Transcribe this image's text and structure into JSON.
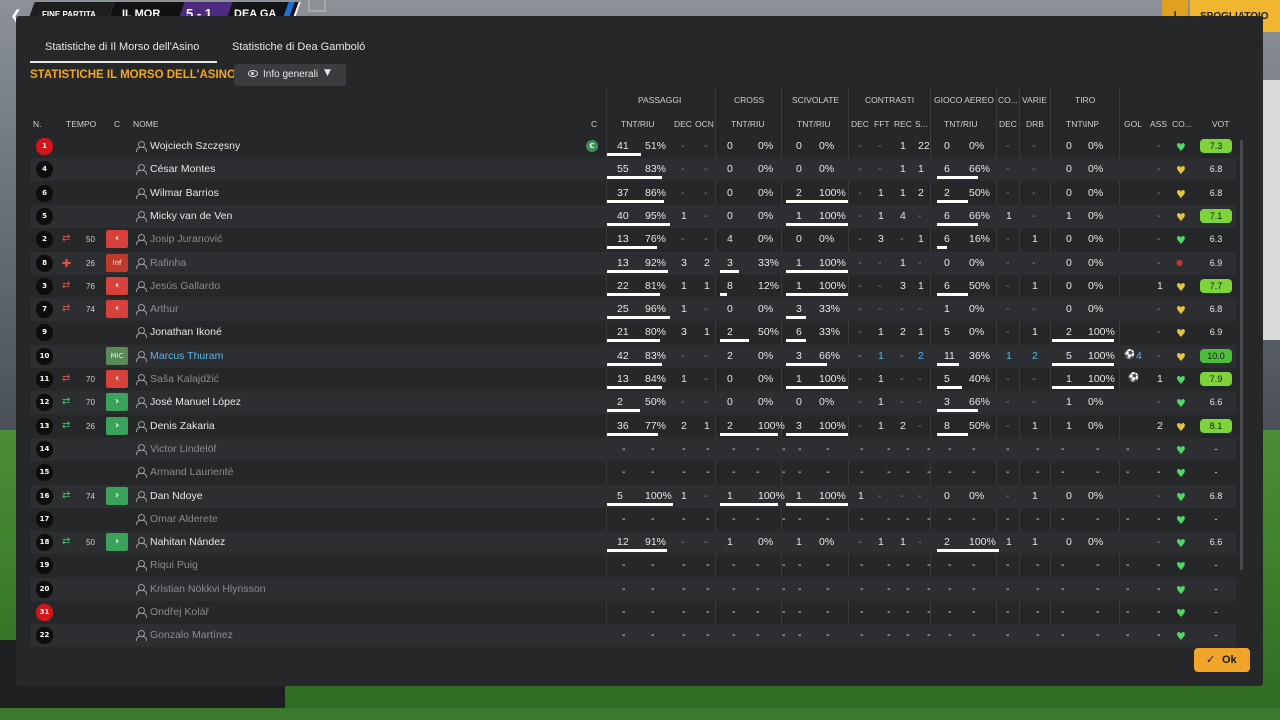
{
  "topbar": {
    "status": "FINE PARTITA",
    "home_short": "IL MOR",
    "score": "5 - 1",
    "away_short": "DEA GA",
    "right_button": "SPOGLIATOIO"
  },
  "tabs": [
    "Statistiche di Il Morso dell'Asino",
    "Statistiche di Dea Gamboló"
  ],
  "section_title": "STATISTICHE IL MORSO DELL'ASINO",
  "view_dropdown": "Info generali",
  "groups": [
    "PASSAGGI",
    "CROSS",
    "SCIVOLATE",
    "CONTRASTI",
    "GIOCO AEREO",
    "CO...",
    "VARIE",
    "TIRO"
  ],
  "columns": {
    "num": "N.",
    "time": "TEMPO",
    "c": "C",
    "name": "NOME",
    "c2": "C",
    "pass_tnt": "TNT/RIU",
    "pass_dec": "DEC",
    "pass_ocn": "OCN",
    "cross_tnt": "TNT/RIU",
    "tackle_tnt": "TNT/RIU",
    "con_dec": "DEC",
    "con_fft": "FFT",
    "con_rec": "REC",
    "con_s": "S...",
    "air_tnt": "TNT/RIU",
    "co_dec": "DEC",
    "var_drb": "DRB",
    "shot_tnt": "TNT\\INP",
    "gol": "GOL",
    "ass": "ASS",
    "co": "CO...",
    "vot": "VOT"
  },
  "colors": {
    "accent": "#f5a623",
    "vote_green": "#7dd33a",
    "heart_green": "#4cd964",
    "heart_yellow": "#e8c43a",
    "sub_out": "#d8413a",
    "sub_in": "#3aa35a"
  },
  "rows": [
    {
      "num": "1",
      "gk": true,
      "time": "",
      "sub": "",
      "name": "Wojciech Szczęsny",
      "dim": false,
      "captain": "C",
      "pass": [
        "41",
        "51%"
      ],
      "pdec": "-",
      "pocn": "-",
      "cross": [
        "0",
        "0%"
      ],
      "tackle": [
        "0",
        "0%"
      ],
      "cdec": "-",
      "cfft": "-",
      "crec": "1",
      "cs": "22",
      "air": [
        "0",
        "0%"
      ],
      "codec": "-",
      "drb": "-",
      "shot": [
        "0",
        "0%"
      ],
      "gol": "",
      "ass": "-",
      "heart": "green",
      "vote": "7.3",
      "vote_style": "green"
    },
    {
      "num": "4",
      "time": "",
      "sub": "",
      "name": "César Montes",
      "pass": [
        "55",
        "83%"
      ],
      "pdec": "-",
      "pocn": "-",
      "cross": [
        "0",
        "0%"
      ],
      "tackle": [
        "0",
        "0%"
      ],
      "cdec": "-",
      "cfft": "-",
      "crec": "1",
      "cs": "1",
      "air": [
        "6",
        "66%"
      ],
      "codec": "-",
      "drb": "-",
      "shot": [
        "0",
        "0%"
      ],
      "gol": "",
      "ass": "-",
      "heart": "yellow",
      "vote": "6.8",
      "vote_style": "plain"
    },
    {
      "num": "6",
      "time": "",
      "sub": "",
      "name": "Wilmar Barrios",
      "pass": [
        "37",
        "86%"
      ],
      "pdec": "-",
      "pocn": "-",
      "cross": [
        "0",
        "0%"
      ],
      "tackle": [
        "2",
        "100%"
      ],
      "cdec": "-",
      "cfft": "1",
      "crec": "1",
      "cs": "2",
      "air": [
        "2",
        "50%"
      ],
      "codec": "-",
      "drb": "-",
      "shot": [
        "0",
        "0%"
      ],
      "gol": "",
      "ass": "-",
      "heart": "yellow",
      "vote": "6.8",
      "vote_style": "plain"
    },
    {
      "num": "5",
      "time": "",
      "sub": "",
      "name": "Micky van de Ven",
      "pass": [
        "40",
        "95%"
      ],
      "pdec": "1",
      "pocn": "-",
      "cross": [
        "0",
        "0%"
      ],
      "tackle": [
        "1",
        "100%"
      ],
      "cdec": "-",
      "cfft": "1",
      "crec": "4",
      "cs": "-",
      "air": [
        "6",
        "66%"
      ],
      "codec": "1",
      "drb": "-",
      "shot": [
        "1",
        "0%"
      ],
      "gol": "",
      "ass": "-",
      "heart": "yellow",
      "vote": "7.1",
      "vote_style": "green"
    },
    {
      "num": "2",
      "time": "50",
      "sub": "out",
      "name": "Josip Juranović",
      "dim": true,
      "pass": [
        "13",
        "76%"
      ],
      "pdec": "-",
      "pocn": "-",
      "cross": [
        "4",
        "0%"
      ],
      "tackle": [
        "0",
        "0%"
      ],
      "cdec": "-",
      "cfft": "3",
      "crec": "-",
      "cs": "1",
      "air": [
        "6",
        "16%"
      ],
      "codec": "-",
      "drb": "1",
      "shot": [
        "0",
        "0%"
      ],
      "gol": "",
      "ass": "-",
      "heart": "green",
      "vote": "6.3",
      "vote_style": "plain"
    },
    {
      "num": "8",
      "time": "26",
      "sub": "inj",
      "name": "Rafinha",
      "dim": true,
      "pass": [
        "13",
        "92%"
      ],
      "pdec": "3",
      "pocn": "2",
      "cross": [
        "3",
        "33%"
      ],
      "tackle": [
        "1",
        "100%"
      ],
      "cdec": "-",
      "cfft": "-",
      "crec": "1",
      "cs": "-",
      "air": [
        "0",
        "0%"
      ],
      "codec": "-",
      "drb": "-",
      "shot": [
        "0",
        "0%"
      ],
      "gol": "",
      "ass": "-",
      "heart": "red",
      "vote": "6.9",
      "vote_style": "plain"
    },
    {
      "num": "3",
      "time": "76",
      "sub": "out",
      "name": "Jesús Gallardo",
      "dim": true,
      "pass": [
        "22",
        "81%"
      ],
      "pdec": "1",
      "pocn": "1",
      "cross": [
        "8",
        "12%"
      ],
      "tackle": [
        "1",
        "100%"
      ],
      "cdec": "-",
      "cfft": "-",
      "crec": "3",
      "cs": "1",
      "air": [
        "6",
        "50%"
      ],
      "codec": "-",
      "drb": "1",
      "shot": [
        "0",
        "0%"
      ],
      "gol": "",
      "ass": "1",
      "heart": "yellow",
      "vote": "7.7",
      "vote_style": "green"
    },
    {
      "num": "7",
      "time": "74",
      "sub": "out",
      "name": "Arthur",
      "dim": true,
      "pass": [
        "25",
        "96%"
      ],
      "pdec": "1",
      "pocn": "-",
      "cross": [
        "0",
        "0%"
      ],
      "tackle": [
        "3",
        "33%"
      ],
      "cdec": "-",
      "cfft": "-",
      "crec": "-",
      "cs": "-",
      "air": [
        "1",
        "0%"
      ],
      "codec": "-",
      "drb": "-",
      "shot": [
        "0",
        "0%"
      ],
      "gol": "",
      "ass": "-",
      "heart": "yellow",
      "vote": "6.8",
      "vote_style": "plain"
    },
    {
      "num": "9",
      "time": "",
      "sub": "",
      "name": "Jonathan Ikoné",
      "pass": [
        "21",
        "80%"
      ],
      "pdec": "3",
      "pocn": "1",
      "cross": [
        "2",
        "50%"
      ],
      "tackle": [
        "6",
        "33%"
      ],
      "cdec": "-",
      "cfft": "1",
      "crec": "2",
      "cs": "1",
      "air": [
        "5",
        "0%"
      ],
      "codec": "-",
      "drb": "1",
      "shot": [
        "2",
        "100%"
      ],
      "gol": "",
      "ass": "-",
      "heart": "yellow",
      "vote": "6.9",
      "vote_style": "plain"
    },
    {
      "num": "10",
      "time": "",
      "sub": "pos",
      "pos_label": "MIC",
      "name": "Marcus Thuram",
      "highlight": true,
      "pass": [
        "42",
        "83%"
      ],
      "pdec": "-",
      "pocn": "-",
      "cross": [
        "2",
        "0%"
      ],
      "tackle": [
        "3",
        "66%"
      ],
      "cdec": "-",
      "cfft": "1",
      "crec": "-",
      "cs": "2",
      "air": [
        "11",
        "36%"
      ],
      "codec": "1",
      "drb": "2",
      "shot": [
        "5",
        "100%"
      ],
      "gol": "4",
      "ass": "-",
      "heart": "yellow",
      "vote": "10.0",
      "vote_style": "dkgreen"
    },
    {
      "num": "11",
      "time": "70",
      "sub": "out",
      "name": "Saša Kalajdžić",
      "dim": true,
      "pass": [
        "13",
        "84%"
      ],
      "pdec": "1",
      "pocn": "-",
      "cross": [
        "0",
        "0%"
      ],
      "tackle": [
        "1",
        "100%"
      ],
      "cdec": "-",
      "cfft": "1",
      "crec": "-",
      "cs": "-",
      "air": [
        "5",
        "40%"
      ],
      "codec": "-",
      "drb": "-",
      "shot": [
        "1",
        "100%"
      ],
      "gol": "ball",
      "ass": "1",
      "heart": "green",
      "vote": "7.9",
      "vote_style": "green"
    },
    {
      "num": "12",
      "time": "70",
      "sub": "in",
      "name": "José Manuel López",
      "pass": [
        "2",
        "50%"
      ],
      "pdec": "-",
      "pocn": "-",
      "cross": [
        "0",
        "0%"
      ],
      "tackle": [
        "0",
        "0%"
      ],
      "cdec": "-",
      "cfft": "1",
      "crec": "-",
      "cs": "-",
      "air": [
        "3",
        "66%"
      ],
      "codec": "-",
      "drb": "-",
      "shot": [
        "1",
        "0%"
      ],
      "gol": "",
      "ass": "-",
      "heart": "green",
      "vote": "6.6",
      "vote_style": "plain"
    },
    {
      "num": "13",
      "time": "26",
      "sub": "in",
      "name": "Denis Zakaria",
      "pass": [
        "36",
        "77%"
      ],
      "pdec": "2",
      "pocn": "1",
      "cross": [
        "2",
        "100%"
      ],
      "tackle": [
        "3",
        "100%"
      ],
      "cdec": "-",
      "cfft": "1",
      "crec": "2",
      "cs": "-",
      "air": [
        "8",
        "50%"
      ],
      "codec": "-",
      "drb": "1",
      "shot": [
        "1",
        "0%"
      ],
      "gol": "",
      "ass": "2",
      "heart": "yellow",
      "vote": "8.1",
      "vote_style": "green"
    },
    {
      "num": "14",
      "time": "",
      "sub": "",
      "name": "Victor Lindelöf",
      "dim": true,
      "empty": true,
      "heart": "green",
      "vote": "-",
      "vote_style": "plain"
    },
    {
      "num": "15",
      "time": "",
      "sub": "",
      "name": "Armand Laurienté",
      "dim": true,
      "empty": true,
      "heart": "green",
      "vote": "-",
      "vote_style": "plain"
    },
    {
      "num": "16",
      "time": "74",
      "sub": "in",
      "name": "Dan Ndoye",
      "pass": [
        "5",
        "100%"
      ],
      "pdec": "1",
      "pocn": "-",
      "cross": [
        "1",
        "100%"
      ],
      "tackle": [
        "1",
        "100%"
      ],
      "cdec": "1",
      "cfft": "-",
      "crec": "-",
      "cs": "-",
      "air": [
        "0",
        "0%"
      ],
      "codec": "-",
      "drb": "1",
      "shot": [
        "0",
        "0%"
      ],
      "gol": "",
      "ass": "-",
      "heart": "green",
      "vote": "6.8",
      "vote_style": "plain"
    },
    {
      "num": "17",
      "time": "",
      "sub": "",
      "name": "Omar Alderete",
      "dim": true,
      "empty": true,
      "heart": "green",
      "vote": "-",
      "vote_style": "plain"
    },
    {
      "num": "18",
      "time": "50",
      "sub": "in",
      "name": "Nahitan Nández",
      "pass": [
        "12",
        "91%"
      ],
      "pdec": "-",
      "pocn": "-",
      "cross": [
        "1",
        "0%"
      ],
      "tackle": [
        "1",
        "0%"
      ],
      "cdec": "-",
      "cfft": "1",
      "crec": "1",
      "cs": "-",
      "air": [
        "2",
        "100%"
      ],
      "codec": "1",
      "drb": "1",
      "shot": [
        "0",
        "0%"
      ],
      "gol": "",
      "ass": "-",
      "heart": "green",
      "vote": "6.6",
      "vote_style": "plain"
    },
    {
      "num": "19",
      "time": "",
      "sub": "",
      "name": "Riqui Puig",
      "dim": true,
      "empty": true,
      "heart": "green",
      "vote": "-",
      "vote_style": "plain"
    },
    {
      "num": "20",
      "time": "",
      "sub": "",
      "name": "Kristian Nökkvi Hlynsson",
      "dim": true,
      "empty": true,
      "heart": "green",
      "vote": "-",
      "vote_style": "plain"
    },
    {
      "num": "31",
      "gk": true,
      "time": "",
      "sub": "",
      "name": "Ondřej Kolář",
      "dim": true,
      "empty": true,
      "heart": "green",
      "vote": "-",
      "vote_style": "plain"
    },
    {
      "num": "22",
      "time": "",
      "sub": "",
      "name": "Gonzalo Martínez",
      "dim": true,
      "empty": true,
      "heart": "green",
      "vote": "-",
      "vote_style": "plain"
    }
  ],
  "ok_button": "Ok"
}
